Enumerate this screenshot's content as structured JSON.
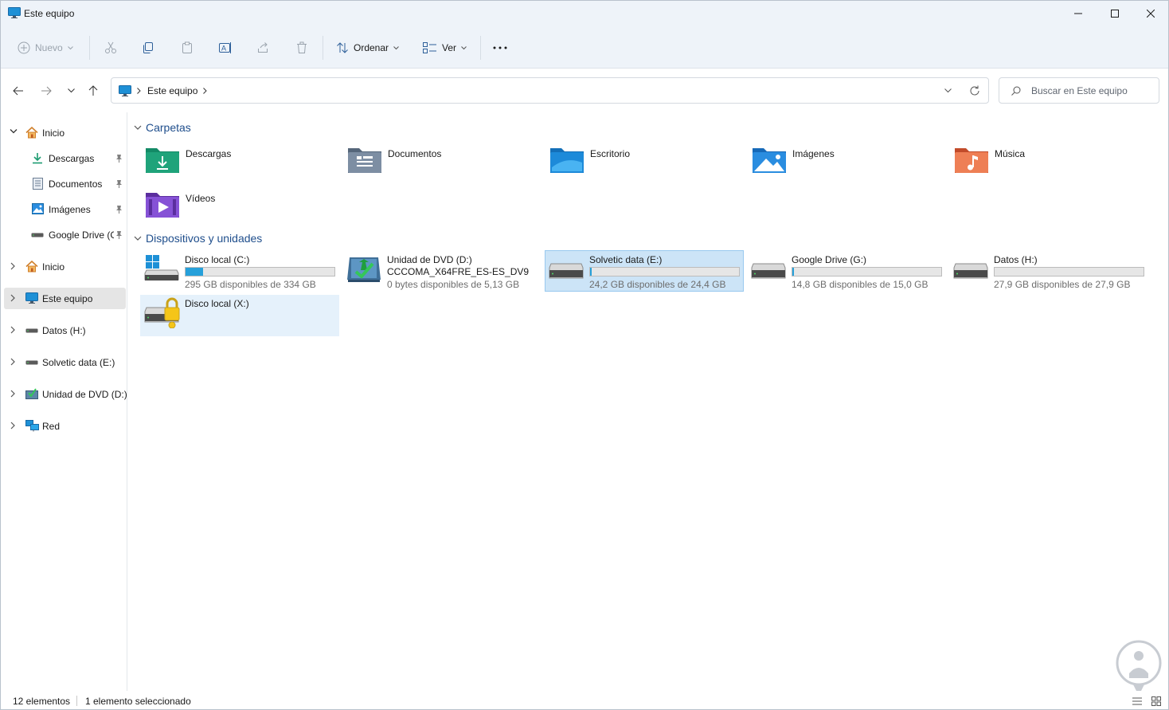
{
  "window": {
    "title": "Este equipo",
    "controls": {
      "minimize": "minimize-icon",
      "maximize": "maximize-icon",
      "close": "close-icon"
    }
  },
  "toolbar": {
    "new_label": "Nuevo",
    "sort_label": "Ordenar",
    "view_label": "Ver",
    "icons": [
      "cut-icon",
      "copy-icon",
      "paste-icon",
      "rename-icon",
      "share-icon",
      "delete-icon",
      "more-icon"
    ]
  },
  "address": {
    "crumbs": [
      "Este equipo"
    ]
  },
  "search": {
    "placeholder": "Buscar en Este equipo"
  },
  "sidebar": {
    "items": [
      {
        "label": "Inicio",
        "icon": "home-icon",
        "expanded": true
      },
      {
        "label": "Descargas",
        "icon": "download-icon",
        "pinned": true
      },
      {
        "label": "Documentos",
        "icon": "document-icon",
        "pinned": true
      },
      {
        "label": "Imágenes",
        "icon": "image-icon",
        "pinned": true
      },
      {
        "label": "Google Drive (G",
        "icon": "drive-icon",
        "pinned": true
      },
      {
        "label": "Inicio",
        "icon": "home-icon"
      },
      {
        "label": "Este equipo",
        "icon": "computer-icon",
        "selected": true
      },
      {
        "label": "Datos (H:)",
        "icon": "drive-icon"
      },
      {
        "label": "Solvetic data (E:)",
        "icon": "drive-icon"
      },
      {
        "label": "Unidad de DVD (D:)",
        "icon": "dvd-icon"
      },
      {
        "label": "Red",
        "icon": "network-icon"
      }
    ]
  },
  "content": {
    "folders_header": "Carpetas",
    "folders": [
      {
        "label": "Descargas",
        "icon": "downloads-folder-icon",
        "color": "#1fa37a"
      },
      {
        "label": "Documentos",
        "icon": "documents-folder-icon",
        "color": "#6b7d93"
      },
      {
        "label": "Escritorio",
        "icon": "desktop-folder-icon",
        "color": "#1d8ad9"
      },
      {
        "label": "Imágenes",
        "icon": "pictures-folder-icon",
        "color": "#2a8de0"
      },
      {
        "label": "Música",
        "icon": "music-folder-icon",
        "color": "#e8673f"
      },
      {
        "label": "Vídeos",
        "icon": "videos-folder-icon",
        "color": "#7b43c9"
      }
    ],
    "devices_header": "Dispositivos y unidades",
    "drives": [
      {
        "name": "Disco local (C:)",
        "sub": "295 GB disponibles de 334 GB",
        "used_fraction": 0.117,
        "icon": "windows-drive-icon"
      },
      {
        "name": "Unidad de DVD (D:)",
        "name2": "CCCOMA_X64FRE_ES-ES_DV9",
        "sub": "0 bytes disponibles de 5,13 GB",
        "icon": "dvd-drive-icon"
      },
      {
        "name": "Solvetic data (E:)",
        "sub": "24,2 GB disponibles de 24,4 GB",
        "used_fraction": 0.008,
        "icon": "hdd-icon",
        "selected": true
      },
      {
        "name": "Google Drive (G:)",
        "sub": "14,8 GB disponibles de 15,0 GB",
        "used_fraction": 0.013,
        "icon": "hdd-icon"
      },
      {
        "name": "Datos (H:)",
        "sub": "27,9 GB disponibles de 27,9 GB",
        "used_fraction": 0.0,
        "icon": "hdd-icon"
      },
      {
        "name": "Disco local (X:)",
        "icon": "locked-drive-icon",
        "hovered": true
      }
    ]
  },
  "status": {
    "count": "12 elementos",
    "selection": "1 elemento seleccionado"
  },
  "colors": {
    "accent": "#1f4e8c",
    "selection_bg": "#cce4f7",
    "bar_fill": "#26a0da",
    "chrome_bg": "#eef3f9"
  }
}
